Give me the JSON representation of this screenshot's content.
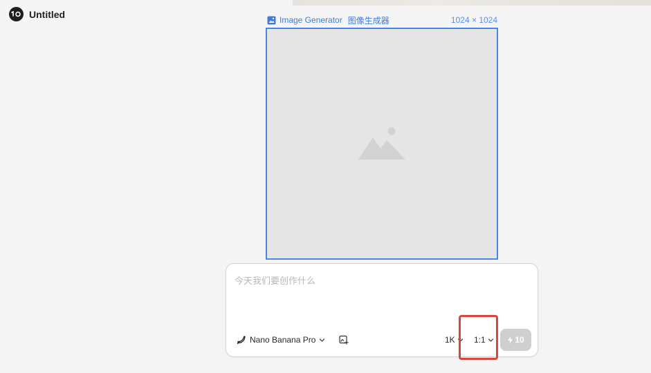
{
  "document": {
    "title": "Untitled",
    "logo_icon": "owl-logo-icon"
  },
  "frame": {
    "label_icon": "image-icon",
    "label": "Image Generator",
    "label_cn": "图像生成器",
    "size": "1024 × 1024",
    "placeholder_icon": "image-placeholder-icon"
  },
  "prompt": {
    "placeholder": "今天我们要创作什么",
    "value": ""
  },
  "controls": {
    "model_icon": "banana-icon",
    "model": "Nano Banana Pro",
    "add_image_icon": "add-image-icon",
    "resolution": "1K",
    "aspect_ratio": "1:1",
    "generate_icon": "lightning-icon",
    "credits": "10"
  },
  "colors": {
    "accent": "#4a86e8",
    "highlight": "#d9453f",
    "frame_fill": "#e5e5e5",
    "button_disabled": "#cfcfcf"
  }
}
